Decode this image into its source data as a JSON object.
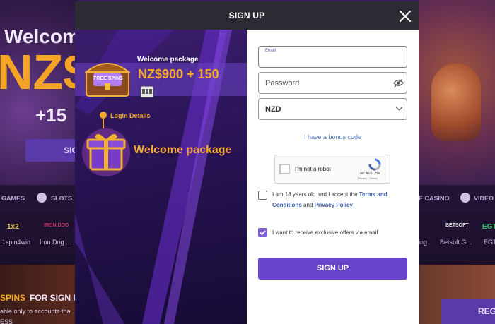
{
  "background": {
    "hero_welcome": "Welcom",
    "hero_amount": "NZ$",
    "hero_spins": "+15",
    "hero_button": "SIG",
    "nav": [
      "GAMES",
      "SLOTS",
      "E CASINO",
      "VIDEO P"
    ],
    "providers": [
      "1spin4win",
      "Iron Dog ...",
      "ing",
      "Betsoft G...",
      "EGT"
    ],
    "provider_logos": [
      "1x2",
      "IRON DOG",
      "BETSOFT",
      "EGT"
    ],
    "promo_title_orange": "SPINS",
    "promo_title_white": "FOR SIGN U",
    "promo_sub": "able only to accounts tha",
    "promo_sub2": "ESS",
    "register_button": "REG"
  },
  "modal": {
    "title": "SIGN UP",
    "close_icon": "close-icon",
    "promo": {
      "welcome_label": "Welcome package",
      "welcome_amount": "NZ$900 + 150",
      "chest_text": "FREE SPINS",
      "step_label": "Login Details",
      "welcome_title": "Welcome package"
    },
    "form": {
      "email_label": "Email",
      "email_value": "",
      "password_placeholder": "Password",
      "currency_value": "NZD",
      "bonus_link": "I have a bonus code",
      "captcha": {
        "text": "I'm not a robot",
        "brand": "reCAPTCHA",
        "links": "Privacy - Terms"
      },
      "terms": {
        "prefix": "I am 18 years old and I accept the",
        "link1": "Terms and Conditions",
        "and": "and",
        "link2": "Privacy Policy",
        "checked": false
      },
      "offers": {
        "label": "I want to receive exclusive offers via email",
        "checked": true
      },
      "submit_label": "SIGN UP"
    }
  },
  "colors": {
    "accent": "#6a45cc",
    "orange": "#f4a82a",
    "header": "#2b2b33",
    "link": "#4a78c2"
  }
}
